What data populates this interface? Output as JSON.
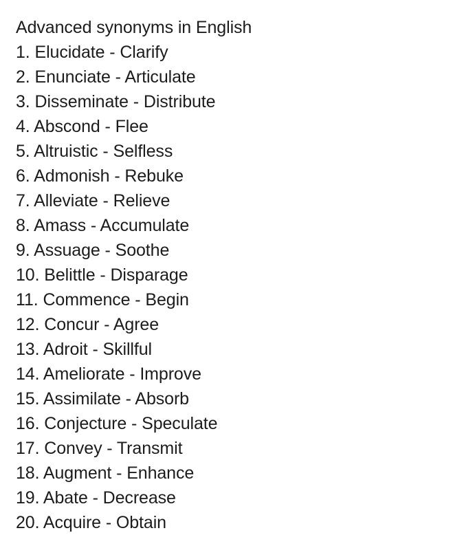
{
  "document": {
    "title": "Advanced synonyms in English",
    "background_color": "#ffffff",
    "text_color": "#1c1c1c",
    "separator": " - ",
    "items": [
      {
        "number": "1.",
        "term": "Elucidate",
        "synonym": "Clarify",
        "line": "1. Elucidate - Clarify"
      },
      {
        "number": "2.",
        "term": "Enunciate",
        "synonym": "Articulate",
        "line": "2. Enunciate - Articulate"
      },
      {
        "number": "3.",
        "term": "Disseminate",
        "synonym": "Distribute",
        "line": "3. Disseminate - Distribute"
      },
      {
        "number": "4.",
        "term": "Abscond",
        "synonym": "Flee",
        "line": "4. Abscond - Flee"
      },
      {
        "number": "5.",
        "term": "Altruistic",
        "synonym": "Selfless",
        "line": "5. Altruistic - Selfless"
      },
      {
        "number": "6.",
        "term": "Admonish",
        "synonym": "Rebuke",
        "line": "6. Admonish - Rebuke"
      },
      {
        "number": "7.",
        "term": "Alleviate",
        "synonym": "Relieve",
        "line": "7. Alleviate - Relieve"
      },
      {
        "number": "8.",
        "term": "Amass",
        "synonym": "Accumulate",
        "line": "8. Amass - Accumulate"
      },
      {
        "number": "9.",
        "term": "Assuage",
        "synonym": "Soothe",
        "line": "9. Assuage - Soothe"
      },
      {
        "number": "10.",
        "term": "Belittle",
        "synonym": "Disparage",
        "line": "10. Belittle - Disparage"
      },
      {
        "number": "11.",
        "term": "Commence",
        "synonym": "Begin",
        "line": "11. Commence - Begin"
      },
      {
        "number": "12.",
        "term": "Concur",
        "synonym": "Agree",
        "line": "12. Concur - Agree"
      },
      {
        "number": "13.",
        "term": "Adroit",
        "synonym": "Skillful",
        "line": "13. Adroit - Skillful"
      },
      {
        "number": "14.",
        "term": "Ameliorate",
        "synonym": "Improve",
        "line": "14. Ameliorate - Improve"
      },
      {
        "number": "15.",
        "term": "Assimilate",
        "synonym": "Absorb",
        "line": "15. Assimilate - Absorb"
      },
      {
        "number": "16.",
        "term": "Conjecture",
        "synonym": "Speculate",
        "line": "16. Conjecture - Speculate"
      },
      {
        "number": "17.",
        "term": "Convey",
        "synonym": "Transmit",
        "line": "17. Convey - Transmit"
      },
      {
        "number": "18.",
        "term": "Augment",
        "synonym": "Enhance",
        "line": "18. Augment - Enhance"
      },
      {
        "number": "19.",
        "term": "Abate",
        "synonym": "Decrease",
        "line": "19. Abate - Decrease"
      },
      {
        "number": "20.",
        "term": "Acquire",
        "synonym": "Obtain",
        "line": "20. Acquire - Obtain"
      }
    ]
  }
}
